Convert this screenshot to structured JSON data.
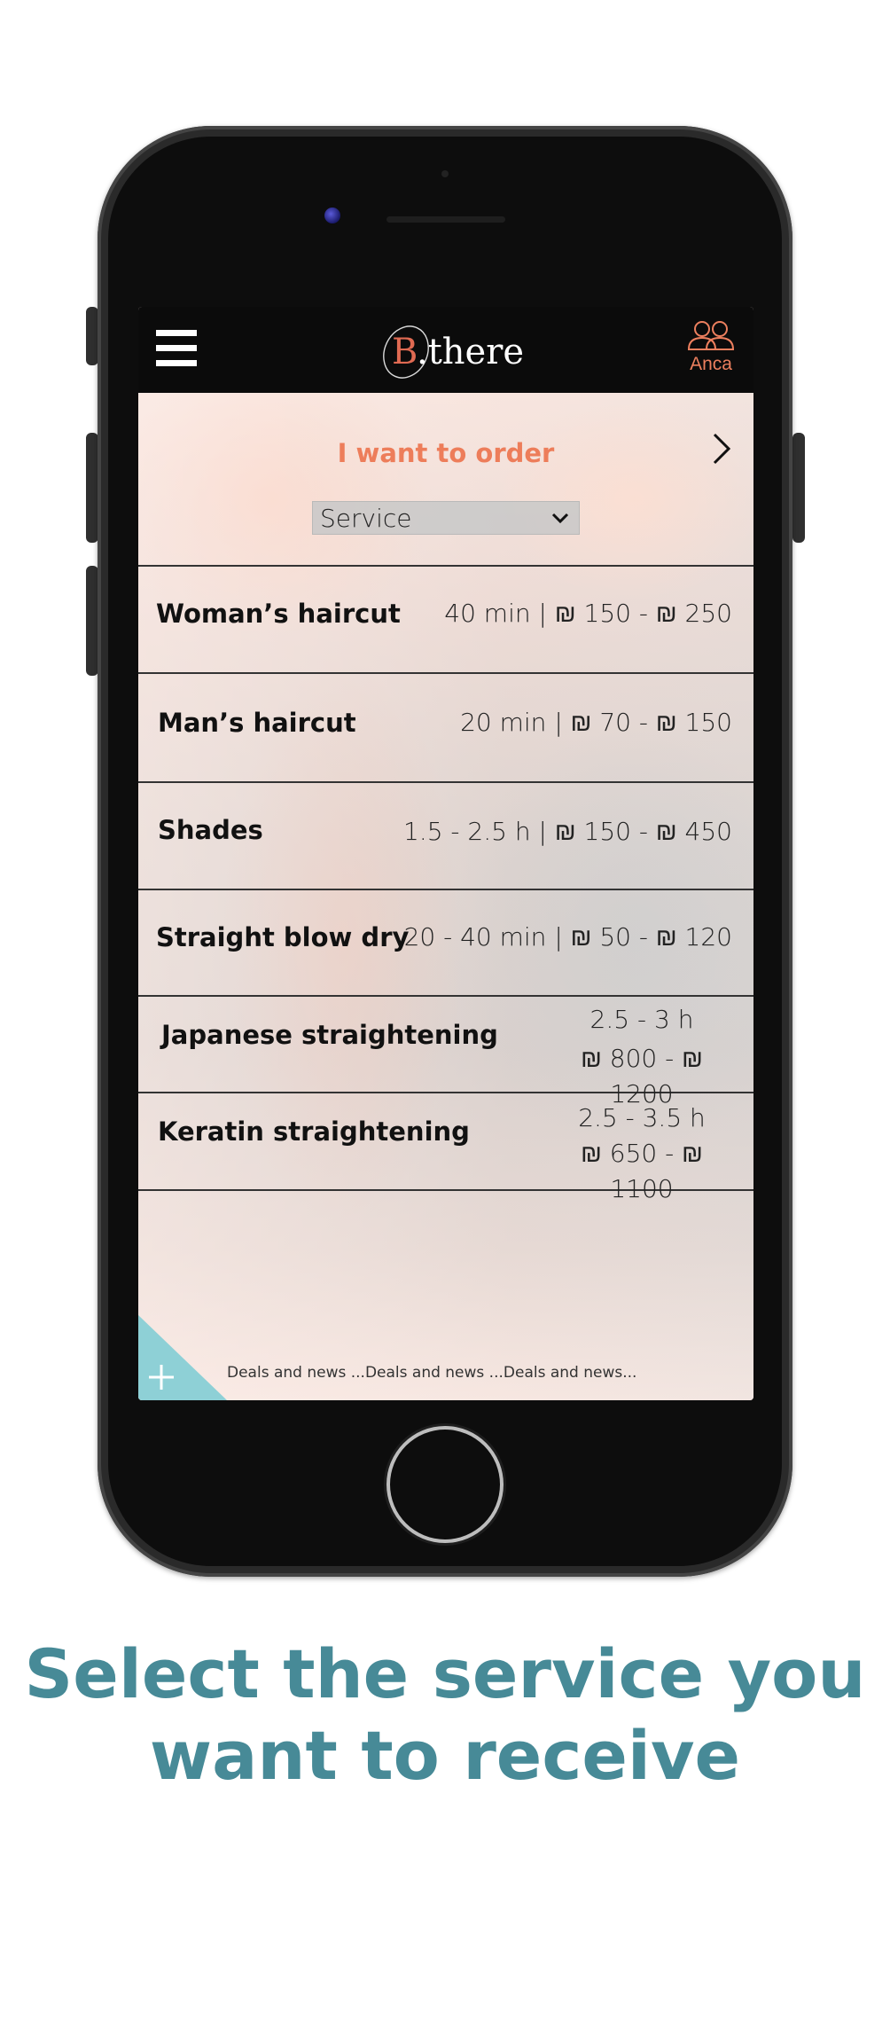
{
  "app": {
    "logo_text": "B.there",
    "user_name": "Anca"
  },
  "order": {
    "title": "I want to order",
    "select_value": "Service"
  },
  "services": [
    {
      "name": "Woman’s haircut",
      "detail": "40 min | ₪ 150 - ₪ 250"
    },
    {
      "name": "Man’s haircut",
      "detail": "20  min | ₪ 70 - ₪ 150"
    },
    {
      "name": "Shades",
      "detail": "1.5 - 2.5 h | ₪ 150 - ₪ 450"
    },
    {
      "name": "Straight blow dry",
      "detail": "20 - 40 min | ₪ 50 - ₪ 120"
    },
    {
      "name": "Japanese straightening",
      "duration": "2.5 - 3 h",
      "price": "₪ 800 - ₪ 1200"
    },
    {
      "name": "Keratin straightening",
      "duration": "2.5 - 3.5 h",
      "price": "₪ 650 - ₪ 1100"
    }
  ],
  "ticker": "Deals and news ...Deals and news ...Deals and news...",
  "caption": {
    "line1": "Select the service you",
    "line2": "want to receive"
  },
  "colors": {
    "accent": "#ed7d5a",
    "caption": "#478a97",
    "add_corner": "#8ed0d6",
    "appbar": "#0b0b0b"
  },
  "icons": {
    "menu": "hamburger-icon",
    "user": "users-icon",
    "next": "chevron-right-icon",
    "select": "chevron-down-icon",
    "add": "plus-icon"
  }
}
